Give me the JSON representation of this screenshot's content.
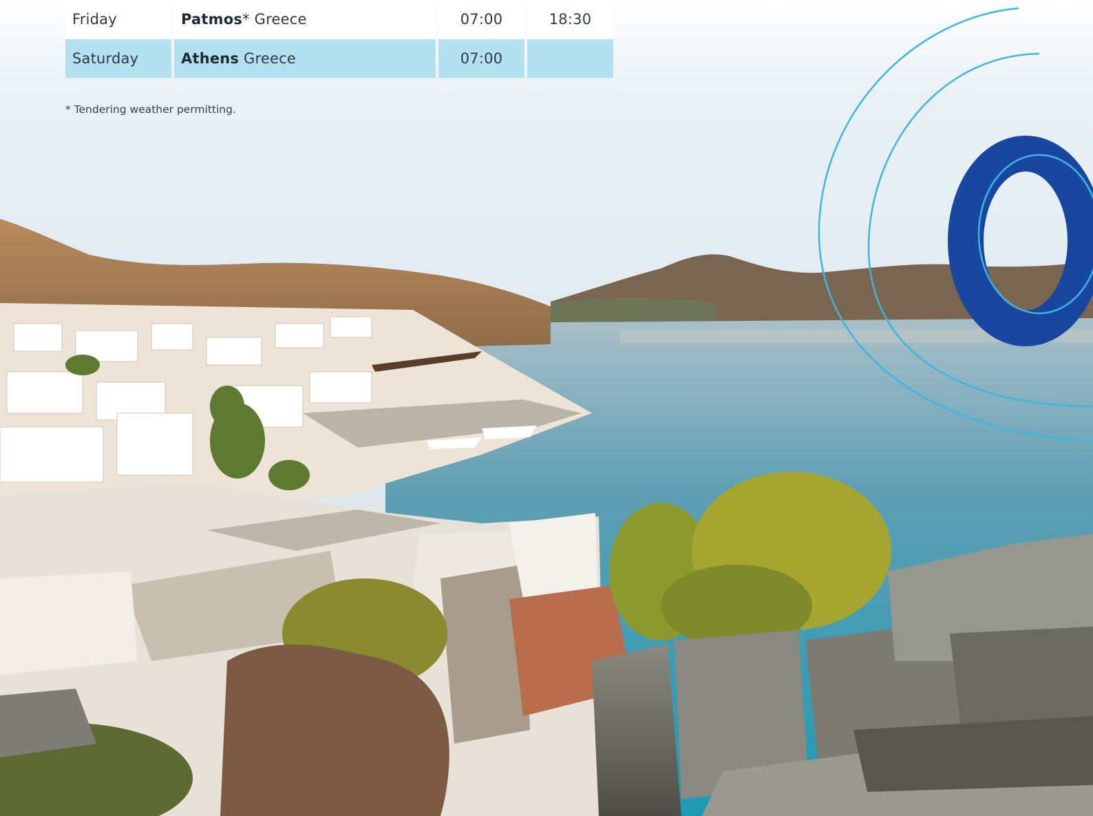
{
  "itinerary": {
    "rows": [
      {
        "day": "Friday",
        "port": "Patmos",
        "port_mark": "*",
        "country": "Greece",
        "arrive": "07:00",
        "depart": "18:30",
        "highlight": false
      },
      {
        "day": "Saturday",
        "port": "Athens",
        "port_mark": "",
        "country": "Greece",
        "arrive": "07:00",
        "depart": "",
        "highlight": true
      }
    ],
    "footnote": "* Tendering weather permitting."
  },
  "colors": {
    "row_highlight": "#b3e1ef",
    "ring_dark": "#1947a0",
    "ring_light": "#3bb6e2"
  }
}
